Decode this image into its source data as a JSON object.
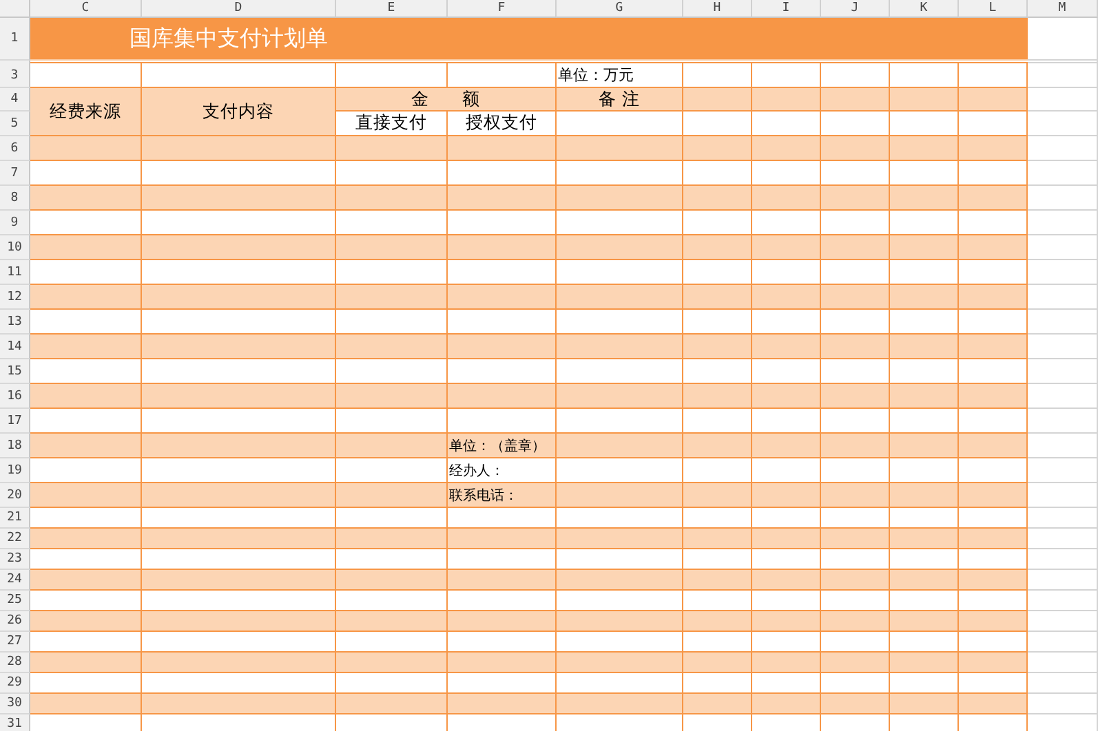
{
  "columns": [
    "C",
    "D",
    "E",
    "F",
    "G",
    "H",
    "I",
    "J",
    "K",
    "L",
    "M"
  ],
  "title_row": {
    "label": "1",
    "text": "国库集中支付计划单"
  },
  "unit_note": "单位：万元",
  "headers": {
    "source": "经费来源",
    "content": "支付内容",
    "amount": "金      额",
    "remarks": "备  注",
    "direct": "直接支付",
    "authorized": "授权支付"
  },
  "signature": [
    "单位：（盖章）",
    "经办人：",
    "联系电话："
  ],
  "rows": [
    {
      "label": "3",
      "shaded": false
    },
    {
      "label": "4",
      "shaded": true
    },
    {
      "label": "5",
      "shaded": false
    },
    {
      "label": "6",
      "shaded": true
    },
    {
      "label": "7",
      "shaded": false
    },
    {
      "label": "8",
      "shaded": true
    },
    {
      "label": "9",
      "shaded": false
    },
    {
      "label": "10",
      "shaded": true
    },
    {
      "label": "11",
      "shaded": false
    },
    {
      "label": "12",
      "shaded": true
    },
    {
      "label": "13",
      "shaded": false
    },
    {
      "label": "14",
      "shaded": true
    },
    {
      "label": "15",
      "shaded": false
    },
    {
      "label": "16",
      "shaded": true
    },
    {
      "label": "17",
      "shaded": false
    },
    {
      "label": "18",
      "shaded": true
    },
    {
      "label": "19",
      "shaded": false
    },
    {
      "label": "20",
      "shaded": true
    },
    {
      "label": "21",
      "shaded": false
    },
    {
      "label": "22",
      "shaded": true
    },
    {
      "label": "23",
      "shaded": false
    },
    {
      "label": "24",
      "shaded": true
    },
    {
      "label": "25",
      "shaded": false
    },
    {
      "label": "26",
      "shaded": true
    },
    {
      "label": "27",
      "shaded": false
    },
    {
      "label": "28",
      "shaded": true
    },
    {
      "label": "29",
      "shaded": false
    },
    {
      "label": "30",
      "shaded": true
    },
    {
      "label": "31",
      "shaded": false
    }
  ]
}
